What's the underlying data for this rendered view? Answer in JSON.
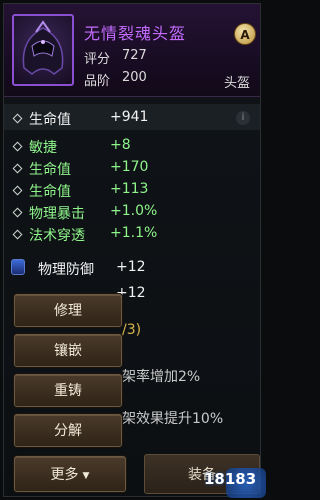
{
  "item": {
    "name": "无情裂魂头盔",
    "score_label": "评分",
    "score": "727",
    "level_label": "品阶",
    "level": "200",
    "slot": "头盔",
    "badge": "A"
  },
  "stats": {
    "main": {
      "label": "生命值",
      "value": "+941"
    },
    "bonus": [
      {
        "label": "敏捷",
        "value": "+8"
      },
      {
        "label": "生命值",
        "value": "+170"
      },
      {
        "label": "生命值",
        "value": "+113"
      },
      {
        "label": "物理暴击",
        "value": "+1.0%"
      },
      {
        "label": "法术穿透",
        "value": "+1.1%"
      }
    ],
    "gems": [
      {
        "label": "物理防御",
        "value": "+12"
      },
      {
        "label": "",
        "value": "+12"
      }
    ]
  },
  "background_text": {
    "progress": "/3)",
    "effect1": "架率增加2%",
    "effect2": "架效果提升10%"
  },
  "menu": {
    "repair": "修理",
    "inlay": "镶嵌",
    "recast": "重铸",
    "decompose": "分解",
    "more": "更多",
    "more_caret": "▼"
  },
  "equip_label": "装备",
  "watermark": "18183",
  "colors": {
    "purple_name": "#c36cff",
    "green_stat": "#8ff58b"
  }
}
